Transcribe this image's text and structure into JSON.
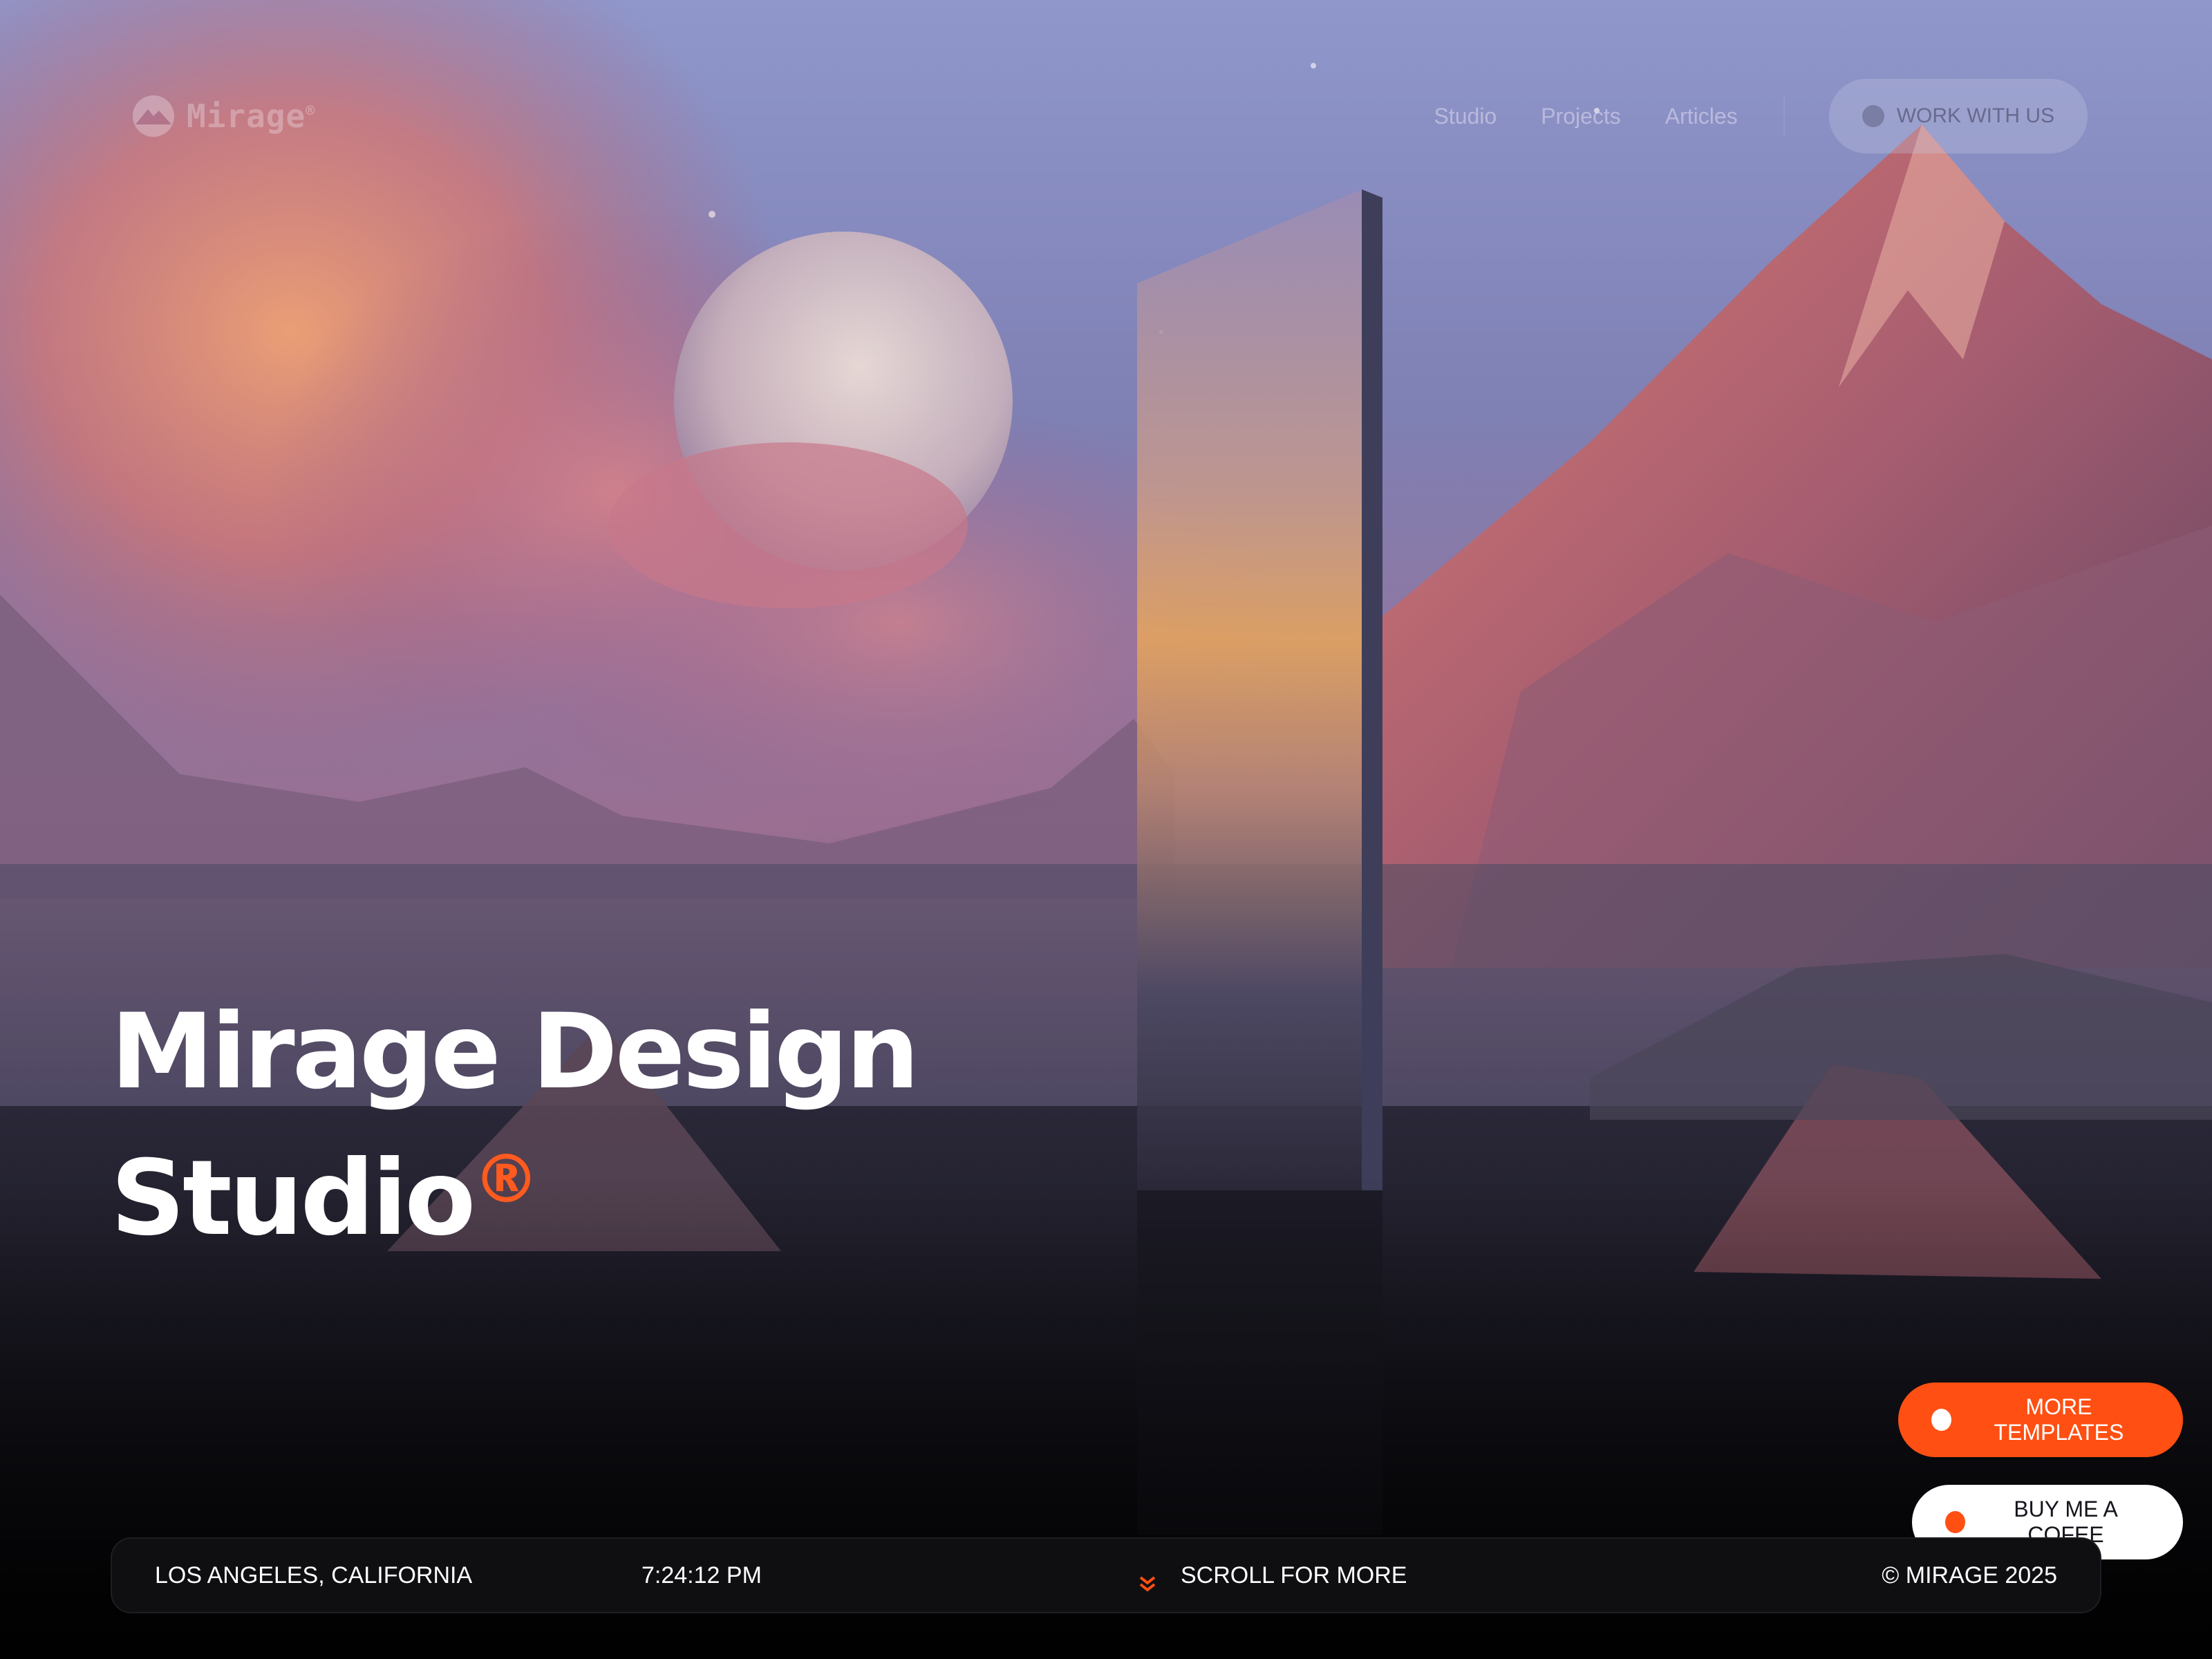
{
  "brand": {
    "logo_text": "Mirage",
    "logo_mark": "®"
  },
  "nav": {
    "links": [
      "Studio",
      "Projects",
      "Articles"
    ],
    "cta": "WORK WITH US"
  },
  "hero": {
    "title_line1": "Mirage Design",
    "title_line2": "Studio",
    "title_mark": "®"
  },
  "floating": {
    "more_templates": "MORE TEMPLATES",
    "buy_coffee": "BUY ME A COFEE"
  },
  "footer_bar": {
    "location": "LOS ANGELES, CALIFORNIA",
    "time": "7:24:12 PM",
    "scroll": "SCROLL FOR MORE",
    "copyright": "© MIRAGE 2025"
  },
  "colors": {
    "accent": "#ff4f12",
    "bar_bg": "#0f0f12",
    "text": "#ffffff"
  }
}
